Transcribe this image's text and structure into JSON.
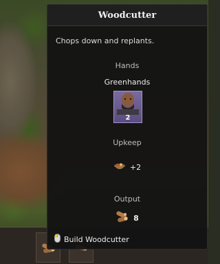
{
  "tooltip": {
    "title": "Woodcutter",
    "description": "Chops down and replants.",
    "hands": {
      "label": "Hands",
      "unit_name": "Greenhands",
      "count": "2"
    },
    "upkeep": {
      "label": "Upkeep",
      "icon": "food-basket-icon",
      "value": "+2"
    },
    "output": {
      "label": "Output",
      "icon": "log-icon",
      "value": "8"
    },
    "build": {
      "icon": "mouse-icon",
      "label": "Build Woodcutter"
    }
  },
  "colors": {
    "tooltip_bg": "#121212",
    "portrait_bg": "#6a5a90",
    "text": "#e8e8e8"
  }
}
